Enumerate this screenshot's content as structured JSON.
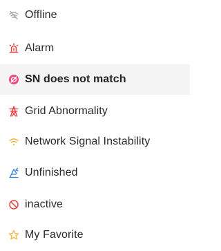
{
  "menu": {
    "items": [
      {
        "label": "Offline",
        "icon": "wifi-off-icon",
        "color": "#9aa0a6",
        "selected": false
      },
      {
        "label": "Alarm",
        "icon": "alarm-beacon-icon",
        "color": "#e53935",
        "selected": false
      },
      {
        "label": "SN does not match",
        "icon": "no-entry-icon",
        "color": "#f0457a",
        "selected": true
      },
      {
        "label": "Grid Abnormality",
        "icon": "transmission-tower-icon",
        "color": "#e53935",
        "selected": false
      },
      {
        "label": "Network Signal Instability",
        "icon": "weak-signal-icon",
        "color": "#f2b43c",
        "selected": false
      },
      {
        "label": "Unfinished",
        "icon": "construction-icon",
        "color": "#2f7fe0",
        "selected": false
      },
      {
        "label": "inactive",
        "icon": "prohibited-icon",
        "color": "#e53935",
        "selected": false
      },
      {
        "label": "My Favorite",
        "icon": "star-outline-icon",
        "color": "#f2b43c",
        "selected": false
      }
    ]
  }
}
